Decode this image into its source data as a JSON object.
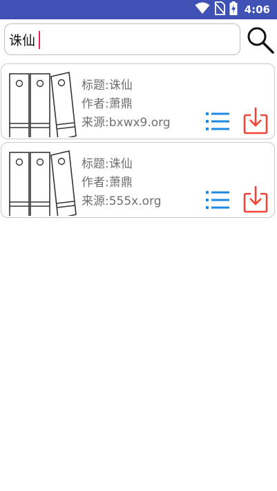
{
  "status_bar": {
    "time": "4:06",
    "icons": [
      "wifi-icon",
      "no-sim-icon",
      "battery-charging-icon"
    ],
    "background_color": "#3F51B5"
  },
  "search": {
    "value": "诛仙",
    "button_icon": "search-icon"
  },
  "results": [
    {
      "title": "标题:诛仙",
      "author": "作者:萧鼎",
      "source": "来源:bxwx9.org",
      "icon": "book-binders-icon"
    },
    {
      "title": "标题:诛仙",
      "author": "作者:萧鼎",
      "source": "来源:555x.org",
      "icon": "book-binders-icon"
    }
  ],
  "colors": {
    "list_icon": "#1E88E5",
    "download_icon": "#F44336",
    "card_text": "#6f6f6f"
  }
}
